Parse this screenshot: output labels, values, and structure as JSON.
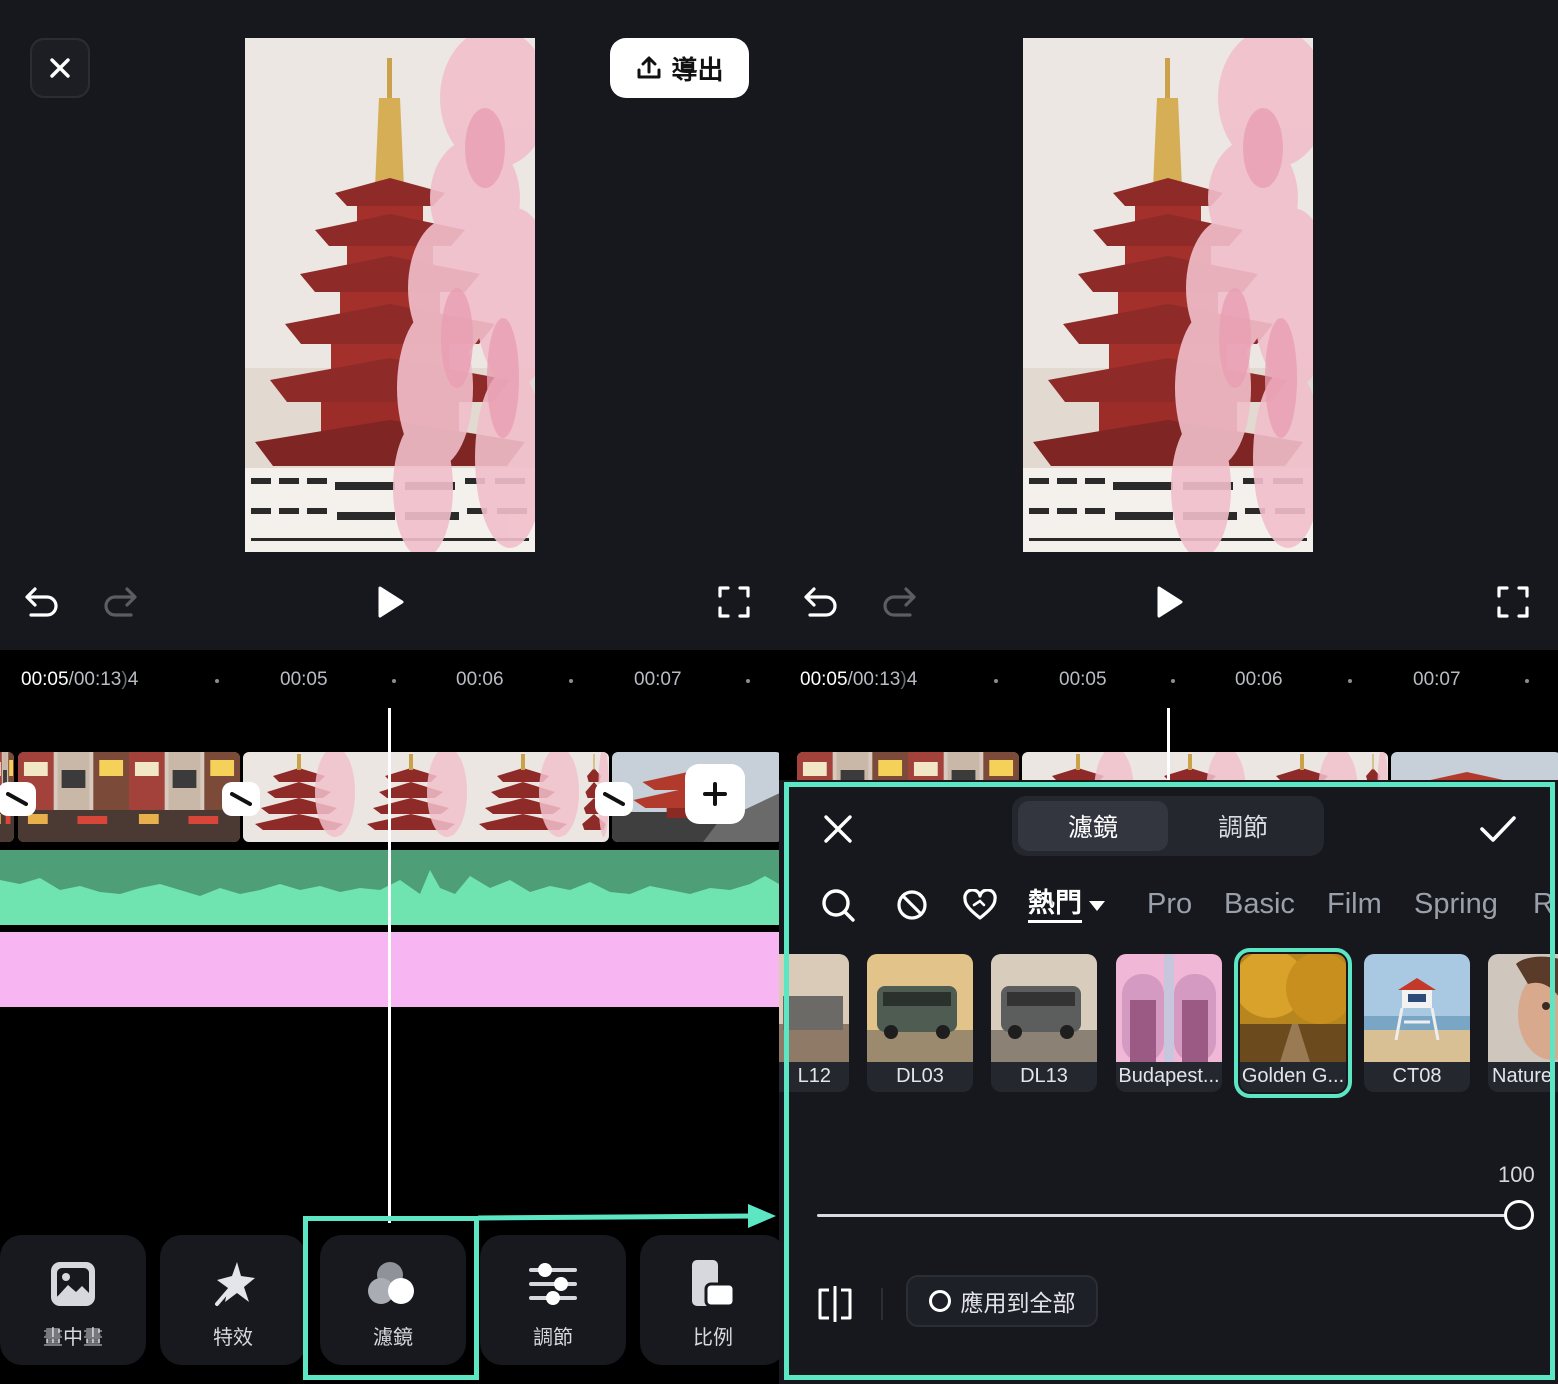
{
  "export_button": {
    "label": "導出"
  },
  "ruler": {
    "current": "00:05",
    "total": "/00:13",
    "total_tail": "4",
    "ticks": [
      "00:05",
      "00:06",
      "00:07"
    ]
  },
  "toolbar": {
    "items": [
      {
        "label": "畫中畫",
        "icon": "picture-in-picture-icon"
      },
      {
        "label": "特效",
        "icon": "effects-star-icon"
      },
      {
        "label": "濾鏡",
        "icon": "filter-circles-icon"
      },
      {
        "label": "調節",
        "icon": "adjust-sliders-icon"
      },
      {
        "label": "比例",
        "icon": "ratio-icon"
      }
    ]
  },
  "filter_panel": {
    "tabs": [
      {
        "label": "濾鏡",
        "active": true
      },
      {
        "label": "調節",
        "active": false
      }
    ],
    "categories": {
      "hot": "熱門",
      "items": [
        "Pro",
        "Basic",
        "Film",
        "Spring",
        "R"
      ]
    },
    "filters": [
      {
        "name": "L12",
        "selected": false
      },
      {
        "name": "DL03",
        "selected": false
      },
      {
        "name": "DL13",
        "selected": false
      },
      {
        "name": "Budapest...",
        "selected": false
      },
      {
        "name": "Golden G...",
        "selected": true
      },
      {
        "name": "CT08",
        "selected": false
      },
      {
        "name": "Nature",
        "selected": false
      }
    ],
    "intensity": {
      "value": "100",
      "level": 1.0
    },
    "apply_all_label": "應用到全部"
  },
  "colors": {
    "accent": "#5de6c4",
    "panel_bg": "#16181d",
    "audio_track": "#4e9e78",
    "pink_track": "#f7b5f2"
  }
}
